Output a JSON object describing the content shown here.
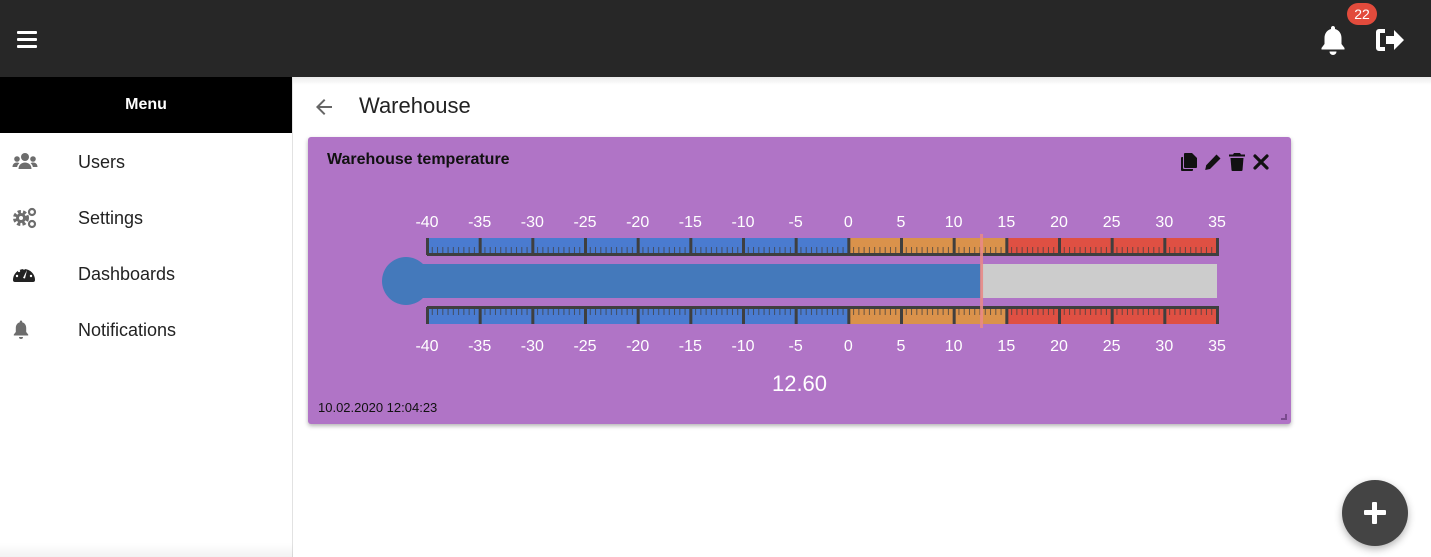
{
  "topbar": {
    "menu_icon": "hamburger-icon",
    "notifications_icon": "bell-icon",
    "notifications_count": "22",
    "logout_icon": "sign-out-icon"
  },
  "sidebar": {
    "header": "Menu",
    "items": [
      {
        "label": "Users",
        "icon": "users-icon"
      },
      {
        "label": "Settings",
        "icon": "cogs-icon"
      },
      {
        "label": "Dashboards",
        "icon": "tachometer-icon"
      },
      {
        "label": "Notifications",
        "icon": "bell-icon"
      }
    ]
  },
  "page": {
    "back_icon": "arrow-left-icon",
    "title": "Warehouse"
  },
  "widget": {
    "title": "Warehouse temperature",
    "actions": [
      {
        "name": "copy",
        "icon": "copy-icon"
      },
      {
        "name": "edit",
        "icon": "pencil-icon"
      },
      {
        "name": "delete",
        "icon": "trash-icon"
      },
      {
        "name": "close",
        "icon": "close-icon"
      }
    ],
    "value_text": "12.60",
    "timestamp": "10.02.2020 12:04:23",
    "colors": {
      "card": "#b074c6",
      "cold": "#4a7bd0",
      "warm": "#da924b",
      "hot": "#df5043",
      "fill": "#4479bb",
      "empty": "#cccccc",
      "marker": "#e88a86",
      "tick": "#3f3f3f",
      "label": "#ffffff"
    }
  },
  "chart_data": {
    "type": "linear-gauge",
    "title": "Warehouse temperature",
    "value": 12.6,
    "min": -40,
    "max": 35,
    "major_step": 5,
    "minor_per_major": 10,
    "tick_labels": [
      "-40",
      "-35",
      "-30",
      "-25",
      "-20",
      "-15",
      "-10",
      "-5",
      "0",
      "5",
      "10",
      "15",
      "20",
      "25",
      "30",
      "35"
    ],
    "bands": [
      {
        "from": -40,
        "to": 0,
        "color": "cold"
      },
      {
        "from": 0,
        "to": 15,
        "color": "warm"
      },
      {
        "from": 15,
        "to": 35,
        "color": "hot"
      }
    ]
  },
  "fab": {
    "icon": "plus-icon"
  }
}
